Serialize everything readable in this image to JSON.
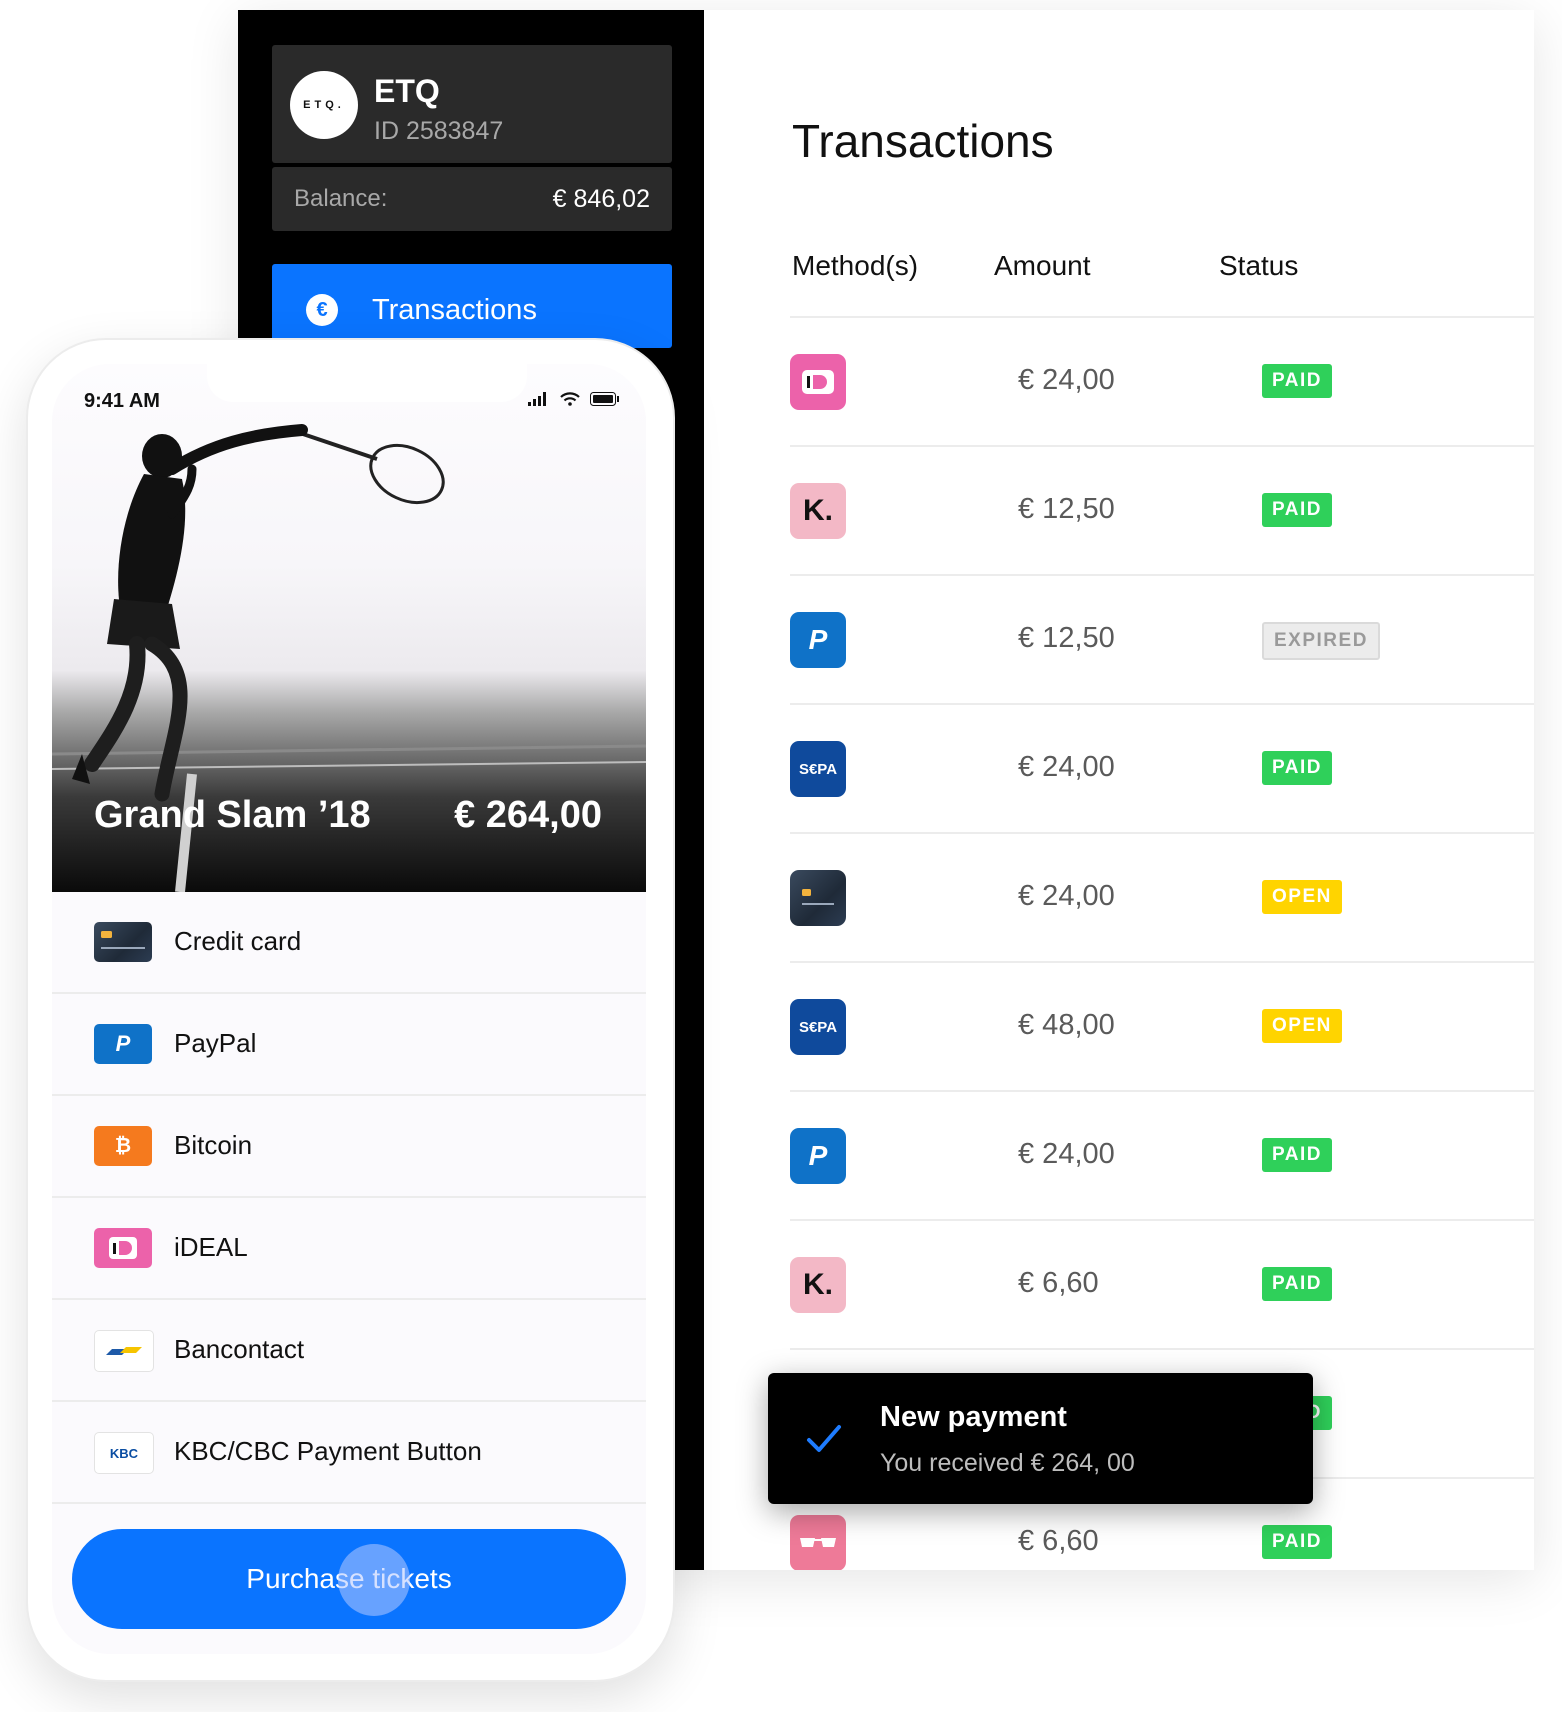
{
  "sidebar": {
    "logo_text": "ETQ.",
    "account_name": "ETQ",
    "account_id": "ID 2583847",
    "balance_label": "Balance:",
    "balance_value": "€ 846,02",
    "nav_icon": "€",
    "nav_active_label": "Transactions"
  },
  "main": {
    "title": "Transactions",
    "columns": [
      "Method(s)",
      "Amount",
      "Status"
    ],
    "rows": [
      {
        "method_icon": "ideal-icon",
        "amount": "€ 24,00",
        "status": "PAID"
      },
      {
        "method_icon": "klarna-icon",
        "amount": "€ 12,50",
        "status": "PAID"
      },
      {
        "method_icon": "paypal-icon",
        "amount": "€ 12,50",
        "status": "EXPIRED"
      },
      {
        "method_icon": "sepa-icon",
        "amount": "€ 24,00",
        "status": "PAID"
      },
      {
        "method_icon": "credit-card-icon",
        "amount": "€ 24,00",
        "status": "OPEN"
      },
      {
        "method_icon": "sepa-icon",
        "amount": "€ 48,00",
        "status": "OPEN"
      },
      {
        "method_icon": "paypal-icon",
        "amount": "€ 24,00",
        "status": "PAID"
      },
      {
        "method_icon": "klarna-icon",
        "amount": "€ 6,60",
        "status": "PAID"
      },
      {
        "method_icon": "hidden",
        "amount": "",
        "status": "PAID"
      },
      {
        "method_icon": "glasses-icon",
        "amount": "€ 6,60",
        "status": "PAID"
      }
    ],
    "icon_text": {
      "klarna": "K.",
      "paypal": "P",
      "sepa": "S€PA"
    }
  },
  "toast": {
    "title": "New payment",
    "message": "You received € 264, 00"
  },
  "phone": {
    "time": "9:41 AM",
    "event_name": "Grand Slam ’18",
    "event_price": "€ 264,00",
    "methods": [
      {
        "label": "Credit card",
        "icon": "credit-card-icon"
      },
      {
        "label": "PayPal",
        "icon": "paypal-icon"
      },
      {
        "label": "Bitcoin",
        "icon": "bitcoin-icon"
      },
      {
        "label": "iDEAL",
        "icon": "ideal-icon"
      },
      {
        "label": "Bancontact",
        "icon": "bancontact-icon"
      },
      {
        "label": "KBC/CBC Payment Button",
        "icon": "kbc-icon"
      }
    ],
    "icon_text": {
      "bitcoin": "₿",
      "paypal": "P",
      "kbc": "KBC"
    },
    "purchase_label": "Purchase tickets"
  },
  "colors": {
    "accent": "#0a74ff",
    "paid": "#2fd05a",
    "open": "#ffd400",
    "expired": "#ececec"
  }
}
